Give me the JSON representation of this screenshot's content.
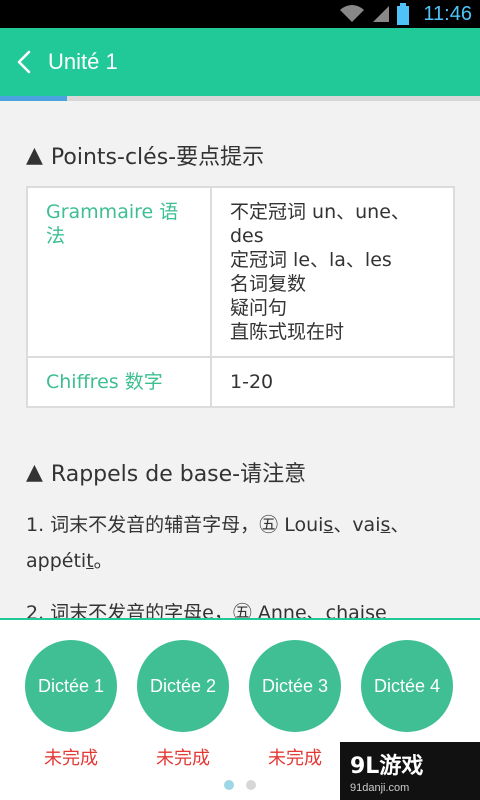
{
  "status_bar": {
    "time": "11:46",
    "icons": [
      "wifi-icon",
      "signal-icon",
      "battery-icon"
    ]
  },
  "app_bar": {
    "title": "Unité 1",
    "back_icon": "chevron-left-icon",
    "color": "#22c998"
  },
  "progress": {
    "value": 0.14
  },
  "section1": {
    "title": "Points-clés-要点提示",
    "marker": "▲"
  },
  "points_table": [
    {
      "key": "Grammaire 语法",
      "values": [
        "不定冠词 un、une、des",
        "定冠词 le、la、les",
        "名词复数",
        "疑问句",
        "直陈式现在时"
      ]
    },
    {
      "key": "Chiffres 数字",
      "values": [
        "1-20"
      ]
    }
  ],
  "section2": {
    "title": "Rappels de base-请注意",
    "marker": "▲"
  },
  "rappels": {
    "p1": {
      "prefix": "1. 词末不发音的辅音字母，㊄ Loui",
      "u1": "s",
      "mid1": "、vai",
      "u2": "s",
      "mid2": "、appéti",
      "u3": "t",
      "suffix": "。"
    },
    "p2": "2. 词末不发音的字母e，㊄ Anne、chaise"
  },
  "dictees": [
    {
      "label": "Dictée 1",
      "status": "未完成"
    },
    {
      "label": "Dictée 2",
      "status": "未完成"
    },
    {
      "label": "Dictée 3",
      "status": "未完成"
    },
    {
      "label": "Dictée 4",
      "status": ""
    }
  ],
  "pager": {
    "pages": 2,
    "current": 1
  },
  "watermark": {
    "logo": "9L游戏",
    "site": "91danji.com"
  }
}
